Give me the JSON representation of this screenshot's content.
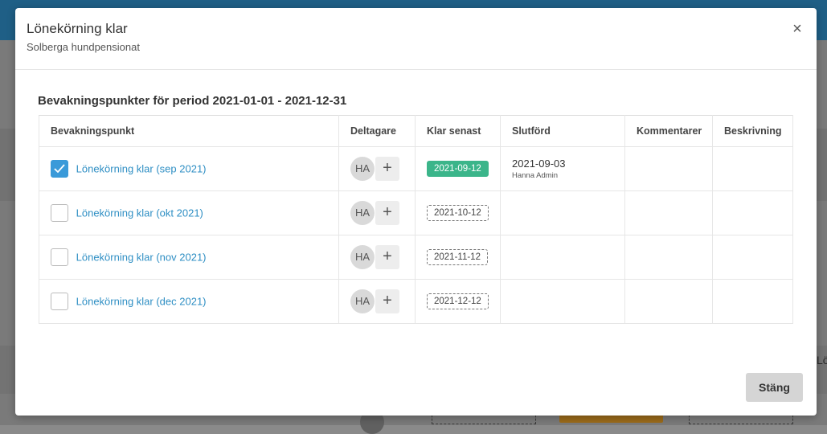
{
  "background": {
    "right_edge_text": "Lö"
  },
  "modal": {
    "title": "Lönekörning klar",
    "subtitle": "Solberga hundpensionat",
    "close_label": "×",
    "section_title": "Bevakningspunkter för period 2021-01-01 - 2021-12-31",
    "close_button_label": "Stäng"
  },
  "table": {
    "headers": {
      "point": "Bevakningspunkt",
      "participants": "Deltagare",
      "due": "Klar senast",
      "completed": "Slutförd",
      "comments": "Kommentarer",
      "description": "Beskrivning"
    },
    "rows": [
      {
        "checked": true,
        "label": "Lönekörning klar (sep 2021)",
        "participant": "HA",
        "add": "+",
        "due": "2021-09-12",
        "completed_date": "2021-09-03",
        "completed_by": "Hanna Admin"
      },
      {
        "checked": false,
        "label": "Lönekörning klar (okt 2021)",
        "participant": "HA",
        "add": "+",
        "due": "2021-10-12",
        "completed_date": "",
        "completed_by": ""
      },
      {
        "checked": false,
        "label": "Lönekörning klar (nov 2021)",
        "participant": "HA",
        "add": "+",
        "due": "2021-11-12",
        "completed_date": "",
        "completed_by": ""
      },
      {
        "checked": false,
        "label": "Lönekörning klar (dec 2021)",
        "participant": "HA",
        "add": "+",
        "due": "2021-12-12",
        "completed_date": "",
        "completed_by": ""
      }
    ]
  },
  "colors": {
    "link": "#2f8fc4",
    "checkbox_checked": "#3a9ad9",
    "done_badge": "#3bb58a",
    "topbar": "#1f5f86"
  }
}
